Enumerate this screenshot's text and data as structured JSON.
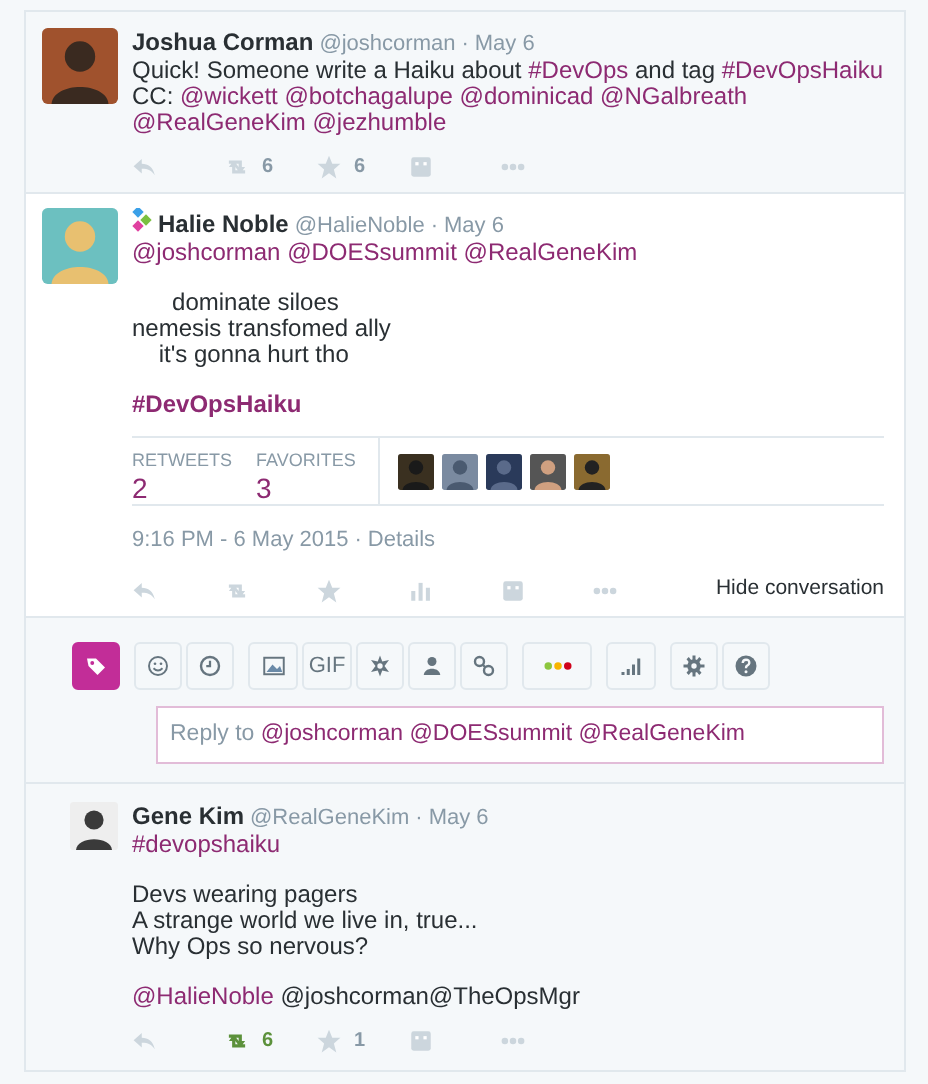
{
  "tweets": [
    {
      "name": "Joshua Corman",
      "handle": "@joshcorman",
      "separator": "·",
      "date": "May 6",
      "app_badge": false,
      "paragraphs": [
        [
          {
            "kind": "text",
            "text": "Quick! Someone write a Haiku about "
          },
          {
            "kind": "link",
            "text": "#DevOps"
          },
          {
            "kind": "text",
            "text": " and tag "
          },
          {
            "kind": "link",
            "text": "#DevOpsHaiku"
          },
          {
            "kind": "text",
            "text": " CC: "
          },
          {
            "kind": "link",
            "text": "@wickett"
          },
          {
            "kind": "link",
            "text": "@botchagalupe"
          },
          {
            "kind": "link",
            "text": "@dominicad"
          },
          {
            "kind": "link",
            "text": "@NGalbreath"
          },
          {
            "kind": "link",
            "text": "@RealGeneKim"
          },
          {
            "kind": "link",
            "text": "@jezhumble"
          }
        ]
      ],
      "actions": [
        {
          "kind": "reply",
          "active": false
        },
        {
          "kind": "retweet",
          "count": "6",
          "active": false
        },
        {
          "kind": "favorite",
          "count": "6",
          "active": false
        },
        {
          "kind": "media",
          "active": false
        },
        {
          "kind": "more",
          "active": false
        }
      ]
    },
    {
      "name": "Halie Noble",
      "handle": "@HalieNoble",
      "separator": "·",
      "date": "May 6",
      "app_badge": true,
      "paragraphs": [
        [
          {
            "kind": "link",
            "text": "@joshcorman"
          },
          {
            "kind": "link",
            "text": "@DOESsummit"
          },
          {
            "kind": "link",
            "text": "@RealGeneKim"
          }
        ],
        [
          {
            "kind": "text",
            "text": "      dominate siloes\nnemesis transfomed ally\n    it's gonna hurt tho"
          }
        ],
        [
          {
            "kind": "hashtag",
            "text": "#DevOpsHaiku"
          }
        ]
      ],
      "stats": [
        {
          "label": "RETWEETS",
          "value": "2"
        },
        {
          "label": "FAVORITES",
          "value": "3"
        }
      ],
      "favoriters": [
        {
          "kind": "picture"
        },
        {
          "kind": "picture"
        },
        {
          "kind": "picture"
        },
        {
          "kind": "picture"
        },
        {
          "kind": "picture"
        }
      ],
      "timestamp": "9:16 PM - 6 May 2015",
      "timestamp_separator": "·",
      "details": "Details",
      "hide": "Hide conversation",
      "actions": [
        {
          "kind": "reply",
          "active": false
        },
        {
          "kind": "retweet",
          "active": false
        },
        {
          "kind": "favorite",
          "active": false
        },
        {
          "kind": "stats",
          "active": false
        },
        {
          "kind": "media",
          "active": false
        },
        {
          "kind": "more",
          "active": false
        }
      ]
    }
  ],
  "composer": {
    "toolbar": [
      [
        {
          "kind": "tag",
          "selected": true
        }
      ],
      [
        {
          "kind": "emoji",
          "selected": false
        },
        {
          "kind": "clock",
          "selected": false
        }
      ],
      [
        {
          "kind": "image",
          "selected": false
        },
        {
          "kind": "gif",
          "label": "GIF",
          "selected": false
        },
        {
          "kind": "gear-star",
          "selected": false
        },
        {
          "kind": "person",
          "selected": false
        },
        {
          "kind": "link",
          "selected": false
        }
      ],
      [
        {
          "kind": "dots",
          "selected": false
        }
      ],
      [
        {
          "kind": "signal",
          "selected": false
        }
      ],
      [
        {
          "kind": "settings",
          "selected": false
        },
        {
          "kind": "help",
          "selected": false
        }
      ]
    ],
    "reply_field": [
      {
        "kind": "text",
        "text": "Reply to "
      },
      {
        "kind": "link",
        "text": "@joshcorman"
      },
      {
        "kind": "link",
        "text": "@DOESsummit"
      },
      {
        "kind": "link",
        "text": "@RealGeneKim"
      }
    ]
  },
  "reply": {
    "name": "Gene Kim",
    "handle": "@RealGeneKim",
    "separator": "·",
    "date": "May 6",
    "app_badge": false,
    "paragraphs": [
      [
        {
          "kind": "link",
          "text": "#devopshaiku"
        }
      ],
      [
        {
          "kind": "text",
          "text": "Devs wearing pagers\nA strange world we live in, true...\nWhy Ops so nervous?"
        }
      ],
      [
        {
          "kind": "link",
          "text": "@HalieNoble"
        },
        {
          "kind": "text",
          "text": " @joshcorman@TheOpsMgr"
        }
      ]
    ],
    "actions": [
      {
        "kind": "reply",
        "active": false
      },
      {
        "kind": "retweet",
        "count": "6",
        "active": true
      },
      {
        "kind": "favorite",
        "count": "1",
        "active": false
      },
      {
        "kind": "media",
        "active": false
      },
      {
        "kind": "more",
        "active": false
      }
    ]
  }
}
